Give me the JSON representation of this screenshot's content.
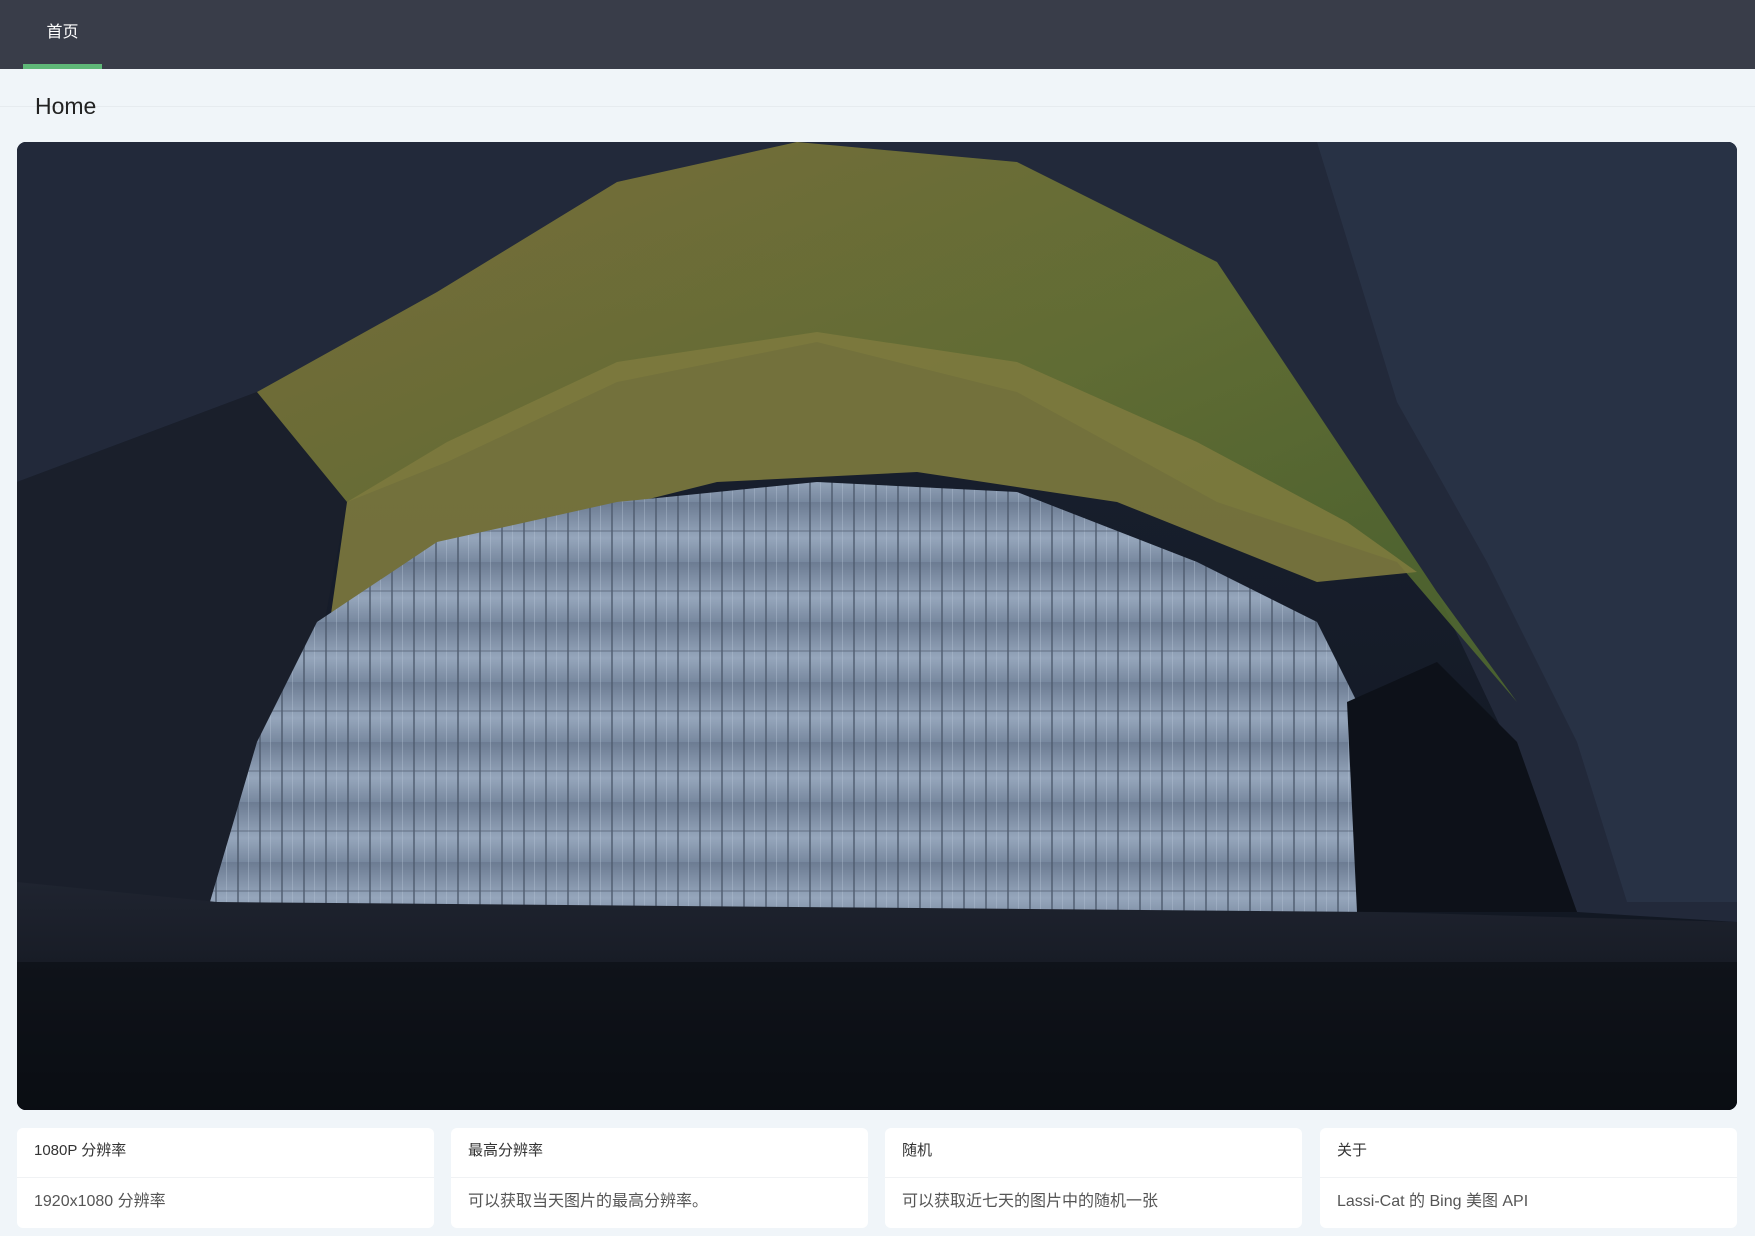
{
  "nav": {
    "tabs": [
      {
        "label": "首页",
        "active": true
      }
    ],
    "active_color": "#5fb878",
    "bar_color": "#393d49"
  },
  "page": {
    "title": "Home"
  },
  "hero_image": {
    "subject": "basalt-columns-sea-cave-photo"
  },
  "cards": [
    {
      "title": "1080P 分辨率",
      "body": "1920x1080 分辨率"
    },
    {
      "title": "最高分辨率",
      "body": "可以获取当天图片的最高分辨率。"
    },
    {
      "title": "随机",
      "body": "可以获取近七天的图片中的随机一张"
    },
    {
      "title": "关于",
      "body": "Lassi-Cat 的 Bing 美图 API"
    }
  ]
}
